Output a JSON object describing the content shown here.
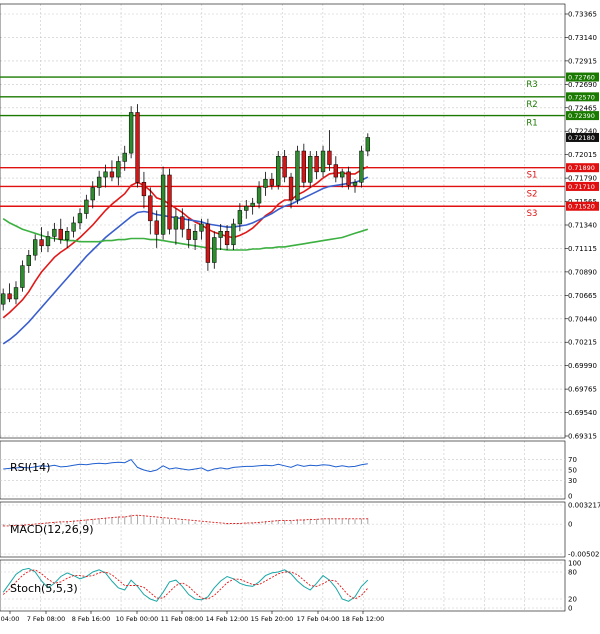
{
  "chart_data": {
    "type": "candlestick",
    "title": "",
    "price_axis": {
      "ylim": [
        0.69315,
        0.73365
      ],
      "ticks": [
        "0.73365",
        "0.73140",
        "0.72915",
        "0.72690",
        "0.72465",
        "0.72240",
        "0.72015",
        "0.71790",
        "0.71565",
        "0.71340",
        "0.71115",
        "0.70890",
        "0.70665",
        "0.70440",
        "0.70215",
        "0.69990",
        "0.69765",
        "0.69540",
        "0.69315"
      ]
    },
    "time_labels": [
      "04:00",
      "7 Feb 08:00",
      "8 Feb 16:00",
      "10 Feb 00:00",
      "11 Feb 08:00",
      "14 Feb 12:00",
      "15 Feb 20:00",
      "17 Feb 04:00",
      "18 Feb 12:00"
    ],
    "current_price": {
      "value": 0.7218,
      "label": "0.72180"
    },
    "levels": [
      {
        "name": "R3",
        "value": 0.7276,
        "label": "0.72760",
        "color": "#1a7a00"
      },
      {
        "name": "R2",
        "value": 0.7257,
        "label": "0.72570",
        "color": "#1a7a00"
      },
      {
        "name": "R1",
        "value": 0.7239,
        "label": "0.72390",
        "color": "#1a7a00"
      },
      {
        "name": "S1",
        "value": 0.7189,
        "label": "0.71890",
        "color": "#e01010"
      },
      {
        "name": "S2",
        "value": 0.7171,
        "label": "0.71710",
        "color": "#e01010"
      },
      {
        "name": "S3",
        "value": 0.7152,
        "label": "0.71520",
        "color": "#e01010"
      }
    ],
    "candles": [
      {
        "o": 0.7058,
        "h": 0.7073,
        "l": 0.7052,
        "c": 0.7068
      },
      {
        "o": 0.7068,
        "h": 0.7078,
        "l": 0.706,
        "c": 0.7063
      },
      {
        "o": 0.7063,
        "h": 0.708,
        "l": 0.7058,
        "c": 0.7074
      },
      {
        "o": 0.7074,
        "h": 0.71,
        "l": 0.707,
        "c": 0.7095
      },
      {
        "o": 0.7095,
        "h": 0.711,
        "l": 0.7088,
        "c": 0.7105
      },
      {
        "o": 0.7105,
        "h": 0.7125,
        "l": 0.71,
        "c": 0.712
      },
      {
        "o": 0.712,
        "h": 0.7132,
        "l": 0.7108,
        "c": 0.7114
      },
      {
        "o": 0.7114,
        "h": 0.7128,
        "l": 0.7108,
        "c": 0.7123
      },
      {
        "o": 0.7123,
        "h": 0.7136,
        "l": 0.7118,
        "c": 0.713
      },
      {
        "o": 0.713,
        "h": 0.714,
        "l": 0.7116,
        "c": 0.712
      },
      {
        "o": 0.712,
        "h": 0.7132,
        "l": 0.7112,
        "c": 0.7128
      },
      {
        "o": 0.7128,
        "h": 0.7142,
        "l": 0.7122,
        "c": 0.7136
      },
      {
        "o": 0.7136,
        "h": 0.715,
        "l": 0.713,
        "c": 0.7145
      },
      {
        "o": 0.7145,
        "h": 0.7163,
        "l": 0.714,
        "c": 0.7158
      },
      {
        "o": 0.7158,
        "h": 0.7176,
        "l": 0.715,
        "c": 0.717
      },
      {
        "o": 0.717,
        "h": 0.7186,
        "l": 0.7162,
        "c": 0.718
      },
      {
        "o": 0.718,
        "h": 0.7192,
        "l": 0.717,
        "c": 0.7185
      },
      {
        "o": 0.7185,
        "h": 0.7196,
        "l": 0.7176,
        "c": 0.718
      },
      {
        "o": 0.718,
        "h": 0.72,
        "l": 0.7172,
        "c": 0.7195
      },
      {
        "o": 0.7195,
        "h": 0.721,
        "l": 0.7186,
        "c": 0.7203
      },
      {
        "o": 0.7203,
        "h": 0.7248,
        "l": 0.7198,
        "c": 0.7242
      },
      {
        "o": 0.7242,
        "h": 0.725,
        "l": 0.717,
        "c": 0.7175
      },
      {
        "o": 0.7175,
        "h": 0.7185,
        "l": 0.715,
        "c": 0.7162
      },
      {
        "o": 0.7162,
        "h": 0.717,
        "l": 0.7125,
        "c": 0.7138
      },
      {
        "o": 0.7138,
        "h": 0.7148,
        "l": 0.7112,
        "c": 0.7125
      },
      {
        "o": 0.7125,
        "h": 0.719,
        "l": 0.712,
        "c": 0.7182
      },
      {
        "o": 0.7182,
        "h": 0.7188,
        "l": 0.7125,
        "c": 0.713
      },
      {
        "o": 0.713,
        "h": 0.715,
        "l": 0.7115,
        "c": 0.7142
      },
      {
        "o": 0.7142,
        "h": 0.715,
        "l": 0.7122,
        "c": 0.713
      },
      {
        "o": 0.713,
        "h": 0.714,
        "l": 0.7112,
        "c": 0.712
      },
      {
        "o": 0.712,
        "h": 0.7135,
        "l": 0.711,
        "c": 0.7128
      },
      {
        "o": 0.7128,
        "h": 0.714,
        "l": 0.712,
        "c": 0.7135
      },
      {
        "o": 0.7135,
        "h": 0.714,
        "l": 0.709,
        "c": 0.7098
      },
      {
        "o": 0.7098,
        "h": 0.7128,
        "l": 0.7092,
        "c": 0.7122
      },
      {
        "o": 0.7122,
        "h": 0.7135,
        "l": 0.711,
        "c": 0.7128
      },
      {
        "o": 0.7128,
        "h": 0.7134,
        "l": 0.711,
        "c": 0.7115
      },
      {
        "o": 0.7115,
        "h": 0.714,
        "l": 0.711,
        "c": 0.7135
      },
      {
        "o": 0.7135,
        "h": 0.7155,
        "l": 0.7128,
        "c": 0.7148
      },
      {
        "o": 0.7148,
        "h": 0.7158,
        "l": 0.714,
        "c": 0.7152
      },
      {
        "o": 0.7152,
        "h": 0.716,
        "l": 0.7144,
        "c": 0.7155
      },
      {
        "o": 0.7155,
        "h": 0.7176,
        "l": 0.715,
        "c": 0.717
      },
      {
        "o": 0.717,
        "h": 0.7185,
        "l": 0.7162,
        "c": 0.7178
      },
      {
        "o": 0.7178,
        "h": 0.7184,
        "l": 0.7168,
        "c": 0.7172
      },
      {
        "o": 0.7172,
        "h": 0.7205,
        "l": 0.7168,
        "c": 0.72
      },
      {
        "o": 0.72,
        "h": 0.7206,
        "l": 0.7175,
        "c": 0.718
      },
      {
        "o": 0.718,
        "h": 0.7184,
        "l": 0.715,
        "c": 0.7158
      },
      {
        "o": 0.7158,
        "h": 0.721,
        "l": 0.7154,
        "c": 0.7205
      },
      {
        "o": 0.7205,
        "h": 0.7212,
        "l": 0.717,
        "c": 0.7175
      },
      {
        "o": 0.7175,
        "h": 0.7205,
        "l": 0.717,
        "c": 0.72
      },
      {
        "o": 0.72,
        "h": 0.7205,
        "l": 0.7178,
        "c": 0.7185
      },
      {
        "o": 0.7185,
        "h": 0.721,
        "l": 0.718,
        "c": 0.7205
      },
      {
        "o": 0.7205,
        "h": 0.7225,
        "l": 0.7186,
        "c": 0.7192
      },
      {
        "o": 0.7192,
        "h": 0.72,
        "l": 0.7175,
        "c": 0.718
      },
      {
        "o": 0.718,
        "h": 0.7188,
        "l": 0.717,
        "c": 0.7185
      },
      {
        "o": 0.7185,
        "h": 0.719,
        "l": 0.7168,
        "c": 0.7172
      },
      {
        "o": 0.7172,
        "h": 0.7178,
        "l": 0.7165,
        "c": 0.7175
      },
      {
        "o": 0.7175,
        "h": 0.721,
        "l": 0.717,
        "c": 0.7205
      },
      {
        "o": 0.7205,
        "h": 0.7222,
        "l": 0.72,
        "c": 0.7218
      }
    ],
    "moving_averages": [
      {
        "color": "#e21818",
        "values": [
          0.7045,
          0.705,
          0.7056,
          0.7062,
          0.707,
          0.708,
          0.7089,
          0.7096,
          0.7103,
          0.7108,
          0.7112,
          0.7117,
          0.7122,
          0.7128,
          0.7134,
          0.7141,
          0.7148,
          0.7154,
          0.7159,
          0.7164,
          0.7172,
          0.7175,
          0.7172,
          0.7167,
          0.716,
          0.7158,
          0.7154,
          0.715,
          0.7146,
          0.7141,
          0.7137,
          0.7134,
          0.713,
          0.7127,
          0.7125,
          0.7123,
          0.7122,
          0.7124,
          0.7127,
          0.7131,
          0.7137,
          0.7143,
          0.7147,
          0.7154,
          0.7158,
          0.7158,
          0.7163,
          0.7166,
          0.717,
          0.7174,
          0.7179,
          0.7183,
          0.7184,
          0.7184,
          0.7183,
          0.7183,
          0.7187,
          0.719
        ]
      },
      {
        "color": "#3a5fcd",
        "values": [
          0.702,
          0.7024,
          0.7029,
          0.7035,
          0.7041,
          0.7048,
          0.7055,
          0.7062,
          0.7069,
          0.7076,
          0.7083,
          0.709,
          0.7097,
          0.7104,
          0.711,
          0.7116,
          0.7122,
          0.7127,
          0.7132,
          0.7137,
          0.7142,
          0.7146,
          0.7147,
          0.7146,
          0.7144,
          0.7143,
          0.7142,
          0.7141,
          0.714,
          0.7139,
          0.7138,
          0.7137,
          0.7135,
          0.7134,
          0.7133,
          0.7132,
          0.7132,
          0.7133,
          0.7134,
          0.7136,
          0.7139,
          0.7142,
          0.7145,
          0.7149,
          0.7152,
          0.7154,
          0.7157,
          0.716,
          0.7163,
          0.7166,
          0.7169,
          0.7171,
          0.7172,
          0.7173,
          0.7174,
          0.7175,
          0.7177,
          0.718
        ]
      },
      {
        "color": "#3cb040",
        "values": [
          0.714,
          0.7136,
          0.7133,
          0.713,
          0.7128,
          0.7126,
          0.7124,
          0.7122,
          0.7121,
          0.712,
          0.7119,
          0.7119,
          0.7118,
          0.7118,
          0.7118,
          0.7118,
          0.7119,
          0.7119,
          0.712,
          0.712,
          0.7121,
          0.7121,
          0.7121,
          0.712,
          0.712,
          0.7119,
          0.7118,
          0.7117,
          0.7116,
          0.7115,
          0.7114,
          0.7113,
          0.7112,
          0.7111,
          0.7111,
          0.711,
          0.711,
          0.711,
          0.711,
          0.7111,
          0.7111,
          0.7112,
          0.7112,
          0.7113,
          0.7113,
          0.7114,
          0.7115,
          0.7116,
          0.7117,
          0.7118,
          0.7119,
          0.712,
          0.7121,
          0.7122,
          0.7124,
          0.7126,
          0.7128,
          0.713
        ]
      }
    ],
    "indicators": {
      "rsi": {
        "label": "RSI(14)",
        "ticks": [
          "70",
          "50",
          "30",
          "0"
        ],
        "ylim": [
          0,
          100
        ],
        "values": [
          52,
          53,
          54,
          55,
          54,
          56,
          58,
          57,
          59,
          56,
          57,
          59,
          61,
          60,
          62,
          63,
          62,
          64,
          65,
          64,
          70,
          55,
          50,
          47,
          50,
          58,
          52,
          54,
          52,
          50,
          52,
          54,
          48,
          52,
          54,
          52,
          55,
          56,
          57,
          57,
          58,
          59,
          58,
          61,
          58,
          55,
          60,
          57,
          59,
          58,
          60,
          59,
          56,
          58,
          56,
          57,
          60,
          62
        ],
        "color": "#1f5fd0"
      },
      "macd": {
        "label": "MACD(12,26,9)",
        "ticks": [
          "0.003217",
          "0",
          "-0.005021"
        ],
        "ylim": [
          -0.005021,
          0.003217
        ],
        "histogram": [
          -0.0004,
          -0.0003,
          -0.0002,
          -0.0001,
          0.0,
          0.0001,
          0.0002,
          0.0003,
          0.0004,
          0.0004,
          0.0005,
          0.0006,
          0.0007,
          0.0008,
          0.0009,
          0.001,
          0.0011,
          0.0012,
          0.0013,
          0.0013,
          0.0016,
          0.0015,
          0.0013,
          0.0011,
          0.0009,
          0.001,
          0.0008,
          0.0007,
          0.0006,
          0.0005,
          0.0004,
          0.0003,
          0.0001,
          0.0,
          0.0,
          -0.0001,
          0.0,
          0.0001,
          0.0002,
          0.0003,
          0.0004,
          0.0005,
          0.0006,
          0.0007,
          0.0007,
          0.0006,
          0.0008,
          0.0008,
          0.0009,
          0.0009,
          0.001,
          0.001,
          0.0009,
          0.0009,
          0.0009,
          0.0008,
          0.0009,
          0.001
        ],
        "signal": [
          -0.0003,
          -0.0003,
          -0.0002,
          -0.0002,
          -0.0001,
          0.0,
          0.0001,
          0.0002,
          0.0003,
          0.0004,
          0.0004,
          0.0005,
          0.0006,
          0.0007,
          0.0008,
          0.0009,
          0.001,
          0.0011,
          0.0012,
          0.0012,
          0.0014,
          0.0015,
          0.0014,
          0.0013,
          0.0012,
          0.0011,
          0.001,
          0.0009,
          0.0008,
          0.0007,
          0.0006,
          0.0005,
          0.0004,
          0.0003,
          0.0002,
          0.0001,
          0.0001,
          0.0001,
          0.0002,
          0.0002,
          0.0003,
          0.0004,
          0.0005,
          0.0006,
          0.0006,
          0.0006,
          0.0007,
          0.0007,
          0.0008,
          0.0008,
          0.0009,
          0.0009,
          0.0009,
          0.0009,
          0.0009,
          0.0009,
          0.0009,
          0.0009
        ],
        "histogram_color": "#a8a8a8",
        "signal_color": "#e21818"
      },
      "stoch": {
        "label": "Stoch(5,5,3)",
        "ticks": [
          "100",
          "80",
          "20",
          "0"
        ],
        "ylim": [
          0,
          100
        ],
        "main": [
          35,
          55,
          75,
          85,
          88,
          80,
          60,
          45,
          55,
          70,
          78,
          72,
          65,
          70,
          80,
          85,
          78,
          60,
          45,
          40,
          62,
          48,
          30,
          20,
          15,
          35,
          58,
          62,
          48,
          30,
          20,
          18,
          25,
          45,
          60,
          70,
          65,
          55,
          50,
          48,
          58,
          72,
          78,
          80,
          85,
          76,
          60,
          48,
          40,
          55,
          72,
          62,
          45,
          20,
          15,
          25,
          48,
          62
        ],
        "signal": [
          30,
          42,
          58,
          72,
          82,
          85,
          76,
          64,
          55,
          58,
          66,
          72,
          72,
          70,
          72,
          78,
          80,
          74,
          62,
          50,
          50,
          50,
          46,
          34,
          22,
          22,
          36,
          50,
          56,
          48,
          34,
          22,
          20,
          28,
          42,
          56,
          64,
          64,
          58,
          52,
          52,
          60,
          68,
          76,
          80,
          80,
          74,
          62,
          50,
          48,
          54,
          62,
          60,
          44,
          28,
          20,
          28,
          44
        ],
        "main_color": "#1aa6a6",
        "signal_color": "#e21818"
      }
    }
  }
}
